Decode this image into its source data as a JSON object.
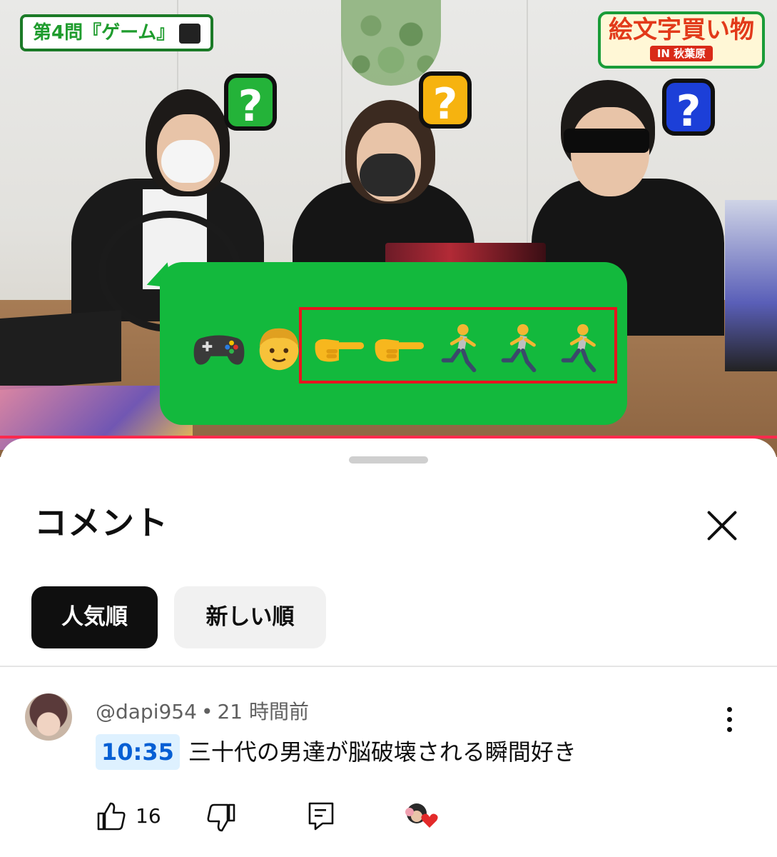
{
  "video": {
    "segment_badge": "第4問『ゲーム』",
    "show_logo_title": "絵文字買い物",
    "show_logo_sub": "IN 秋葉原",
    "question_marks": [
      "?",
      "?",
      "?"
    ],
    "emoji_message": [
      "🎮",
      "👦",
      "👉",
      "👉",
      "🏃",
      "🏃",
      "🏃"
    ],
    "colors": {
      "bubble": "#13b93d",
      "highlight": "#e8141f",
      "progress": "#ff2a4d"
    }
  },
  "sheet": {
    "title": "コメント",
    "close_icon": "close-icon",
    "sort_tabs": [
      {
        "label": "人気順",
        "active": true
      },
      {
        "label": "新しい順",
        "active": false
      }
    ]
  },
  "comment": {
    "author": "@dapi954",
    "separator": "•",
    "time": "21 時間前",
    "timestamp": "10:35",
    "text": "三十代の男達が脳破壊される瞬間好き",
    "likes": "16",
    "icons": [
      "thumbs-up-icon",
      "thumbs-down-icon",
      "reply-icon",
      "creator-heart-icon",
      "more-vert-icon"
    ]
  }
}
